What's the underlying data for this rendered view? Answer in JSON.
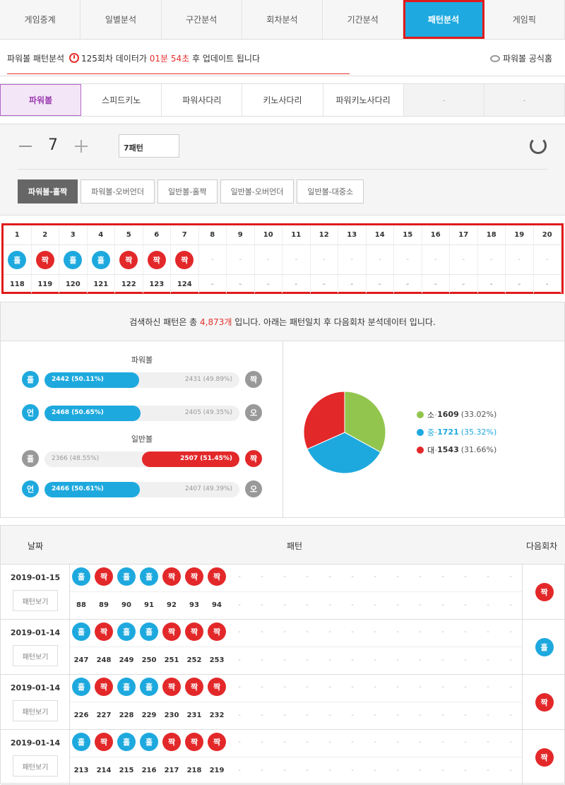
{
  "topnav": {
    "items": [
      "게임중계",
      "일별분석",
      "구간분석",
      "회차분석",
      "기간분석",
      "패턴분석",
      "게임픽"
    ],
    "active": 5
  },
  "info": {
    "prefix": "파워볼 패턴분석",
    "round": "125회차",
    "mid": "데이터가",
    "time": "01분 54초",
    "suffix": "후 업데이트 됩니다",
    "home": "파워볼 공식홈"
  },
  "gametabs": {
    "items": [
      "파워볼",
      "스피드키노",
      "파워사다리",
      "키노사다리",
      "파워키노사다리",
      "-",
      "-"
    ],
    "active": 0
  },
  "control": {
    "count": "7",
    "pattern_select": "7패턴",
    "subtabs": [
      "파워볼-홀짝",
      "파워볼-오버언더",
      "일반볼-홀짝",
      "일반볼-오버언더",
      "일반볼-대중소"
    ],
    "active": 0
  },
  "pattern_grid": {
    "headers": [
      "1",
      "2",
      "3",
      "4",
      "5",
      "6",
      "7",
      "8",
      "9",
      "10",
      "11",
      "12",
      "13",
      "14",
      "15",
      "16",
      "17",
      "18",
      "19",
      "20"
    ],
    "balls": [
      "홀",
      "짝",
      "홀",
      "홀",
      "짝",
      "짝",
      "짝",
      "-",
      "-",
      "-",
      "-",
      "-",
      "-",
      "-",
      "-",
      "-",
      "-",
      "-",
      "-",
      "-"
    ],
    "rounds": [
      "118",
      "119",
      "120",
      "121",
      "122",
      "123",
      "124",
      "-",
      "-",
      "-",
      "-",
      "-",
      "-",
      "-",
      "-",
      "-",
      "-",
      "-",
      "-",
      "-"
    ]
  },
  "summary": {
    "pre": "검색하신 패턴은 총",
    "count": "4,873개",
    "post": "입니다. 아래는 패턴일치 후 다음회차 분석데이터 입니다."
  },
  "stats": {
    "powerball_title": "파워볼",
    "normal_title": "일반볼",
    "rows": [
      {
        "left": "홀",
        "right": "짝",
        "lval": "2442 (50.11%)",
        "rval": "2431 (49.89%)",
        "win": "left",
        "pct": 50.11
      },
      {
        "left": "언",
        "right": "오",
        "lval": "2468 (50.65%)",
        "rval": "2405 (49.35%)",
        "win": "left",
        "pct": 50.65
      },
      {
        "left": "홀",
        "right": "짝",
        "lval": "2366 (48.55%)",
        "rval": "2507 (51.45%)",
        "win": "right",
        "pct": 51.45
      },
      {
        "left": "언",
        "right": "오",
        "lval": "2466 (50.61%)",
        "rval": "2407 (49.39%)",
        "win": "left",
        "pct": 50.61
      }
    ]
  },
  "chart_data": {
    "type": "pie",
    "categories": [
      "소",
      "중",
      "대"
    ],
    "values": [
      1609,
      1721,
      1543
    ],
    "labels": [
      "(33.02%)",
      "(35.32%)",
      "(31.66%)"
    ],
    "colors": [
      "#92c54e",
      "#1ea9de",
      "#e3282a"
    ]
  },
  "history": {
    "headers": {
      "date": "날짜",
      "pattern": "패턴",
      "next": "다음회차"
    },
    "view_label": "패턴보기",
    "rows": [
      {
        "date": "2019-01-15",
        "balls": [
          "홀",
          "짝",
          "홀",
          "홀",
          "짝",
          "짝",
          "짝"
        ],
        "rounds": [
          "88",
          "89",
          "90",
          "91",
          "92",
          "93",
          "94"
        ],
        "next": "짝"
      },
      {
        "date": "2019-01-14",
        "balls": [
          "홀",
          "짝",
          "홀",
          "홀",
          "짝",
          "짝",
          "짝"
        ],
        "rounds": [
          "247",
          "248",
          "249",
          "250",
          "251",
          "252",
          "253"
        ],
        "next": "홀"
      },
      {
        "date": "2019-01-14",
        "balls": [
          "홀",
          "짝",
          "홀",
          "홀",
          "짝",
          "짝",
          "짝"
        ],
        "rounds": [
          "226",
          "227",
          "228",
          "229",
          "230",
          "231",
          "232"
        ],
        "next": "짝"
      },
      {
        "date": "2019-01-14",
        "balls": [
          "홀",
          "짝",
          "홀",
          "홀",
          "짝",
          "짝",
          "짝"
        ],
        "rounds": [
          "213",
          "214",
          "215",
          "216",
          "217",
          "218",
          "219"
        ],
        "next": "짝"
      }
    ]
  },
  "colors": {
    "odd": "#1ea9de",
    "even": "#e3282a",
    "neutral": "#999999",
    "accent": "#1eaae0"
  }
}
